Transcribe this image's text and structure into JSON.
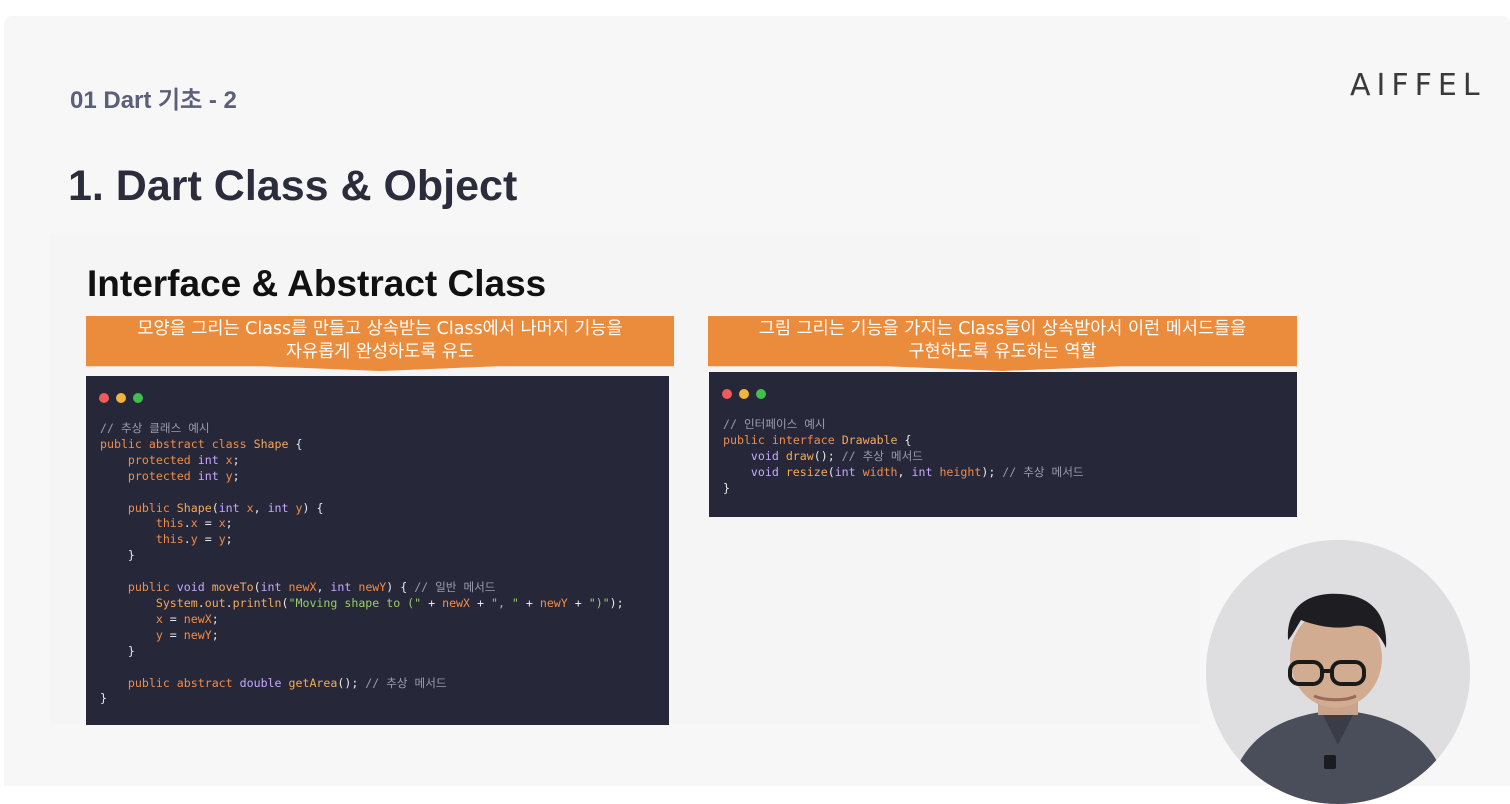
{
  "header": {
    "section_label": "01 Dart  기초 - 2",
    "logo_text": "AIFFEL",
    "title": "1. Dart Class & Object"
  },
  "content": {
    "subtitle": "Interface & Abstract Class",
    "callout_left": {
      "line1": "모양을 그리는 Class를 만들고 상속받는 Class에서 나머지 기능을",
      "line2": "자유롭게 완성하도록 유도"
    },
    "callout_right": {
      "line1": "그림 그리는 기능을 가지는 Class들이 상속받아서 이런 메서드들을",
      "line2": "구현하도록 유도하는 역할"
    },
    "code_left_lines": [
      [
        [
          "c-comment",
          "// 추상 클래스 예시"
        ]
      ],
      [
        [
          "c-kw",
          "public"
        ],
        [
          "c-plain",
          " "
        ],
        [
          "c-kw",
          "abstract"
        ],
        [
          "c-plain",
          " "
        ],
        [
          "c-kw",
          "class"
        ],
        [
          "c-plain",
          " "
        ],
        [
          "c-fn",
          "Shape"
        ],
        [
          "c-plain",
          " {"
        ]
      ],
      [
        [
          "c-plain",
          "    "
        ],
        [
          "c-kw",
          "protected"
        ],
        [
          "c-plain",
          " "
        ],
        [
          "c-type",
          "int"
        ],
        [
          "c-plain",
          " "
        ],
        [
          "c-var",
          "x"
        ],
        [
          "c-plain",
          ";"
        ]
      ],
      [
        [
          "c-plain",
          "    "
        ],
        [
          "c-kw",
          "protected"
        ],
        [
          "c-plain",
          " "
        ],
        [
          "c-type",
          "int"
        ],
        [
          "c-plain",
          " "
        ],
        [
          "c-var",
          "y"
        ],
        [
          "c-plain",
          ";"
        ]
      ],
      [
        [
          "c-plain",
          ""
        ]
      ],
      [
        [
          "c-plain",
          "    "
        ],
        [
          "c-kw",
          "public"
        ],
        [
          "c-plain",
          " "
        ],
        [
          "c-fn",
          "Shape"
        ],
        [
          "c-plain",
          "("
        ],
        [
          "c-type",
          "int"
        ],
        [
          "c-plain",
          " "
        ],
        [
          "c-var",
          "x"
        ],
        [
          "c-plain",
          ", "
        ],
        [
          "c-type",
          "int"
        ],
        [
          "c-plain",
          " "
        ],
        [
          "c-var",
          "y"
        ],
        [
          "c-plain",
          ") {"
        ]
      ],
      [
        [
          "c-plain",
          "        "
        ],
        [
          "c-kw",
          "this"
        ],
        [
          "c-plain",
          "."
        ],
        [
          "c-var",
          "x"
        ],
        [
          "c-plain",
          " = "
        ],
        [
          "c-var",
          "x"
        ],
        [
          "c-plain",
          ";"
        ]
      ],
      [
        [
          "c-plain",
          "        "
        ],
        [
          "c-kw",
          "this"
        ],
        [
          "c-plain",
          "."
        ],
        [
          "c-var",
          "y"
        ],
        [
          "c-plain",
          " = "
        ],
        [
          "c-var",
          "y"
        ],
        [
          "c-plain",
          ";"
        ]
      ],
      [
        [
          "c-plain",
          "    }"
        ]
      ],
      [
        [
          "c-plain",
          ""
        ]
      ],
      [
        [
          "c-plain",
          "    "
        ],
        [
          "c-kw",
          "public"
        ],
        [
          "c-plain",
          " "
        ],
        [
          "c-type",
          "void"
        ],
        [
          "c-plain",
          " "
        ],
        [
          "c-fn",
          "moveTo"
        ],
        [
          "c-plain",
          "("
        ],
        [
          "c-type",
          "int"
        ],
        [
          "c-plain",
          " "
        ],
        [
          "c-var",
          "newX"
        ],
        [
          "c-plain",
          ", "
        ],
        [
          "c-type",
          "int"
        ],
        [
          "c-plain",
          " "
        ],
        [
          "c-var",
          "newY"
        ],
        [
          "c-plain",
          ") { "
        ],
        [
          "c-comment",
          "// 일반 메서드"
        ]
      ],
      [
        [
          "c-plain",
          "        "
        ],
        [
          "c-fn",
          "System"
        ],
        [
          "c-plain",
          "."
        ],
        [
          "c-fn",
          "out"
        ],
        [
          "c-plain",
          "."
        ],
        [
          "c-fn",
          "println"
        ],
        [
          "c-plain",
          "("
        ],
        [
          "c-str",
          "\"Moving shape to (\""
        ],
        [
          "c-plain",
          " + "
        ],
        [
          "c-var",
          "newX"
        ],
        [
          "c-plain",
          " + "
        ],
        [
          "c-str",
          "\", \""
        ],
        [
          "c-plain",
          " + "
        ],
        [
          "c-var",
          "newY"
        ],
        [
          "c-plain",
          " + "
        ],
        [
          "c-str",
          "\")\""
        ],
        [
          "c-plain",
          ");"
        ]
      ],
      [
        [
          "c-plain",
          "        "
        ],
        [
          "c-var",
          "x"
        ],
        [
          "c-plain",
          " = "
        ],
        [
          "c-var",
          "newX"
        ],
        [
          "c-plain",
          ";"
        ]
      ],
      [
        [
          "c-plain",
          "        "
        ],
        [
          "c-var",
          "y"
        ],
        [
          "c-plain",
          " = "
        ],
        [
          "c-var",
          "newY"
        ],
        [
          "c-plain",
          ";"
        ]
      ],
      [
        [
          "c-plain",
          "    }"
        ]
      ],
      [
        [
          "c-plain",
          ""
        ]
      ],
      [
        [
          "c-plain",
          "    "
        ],
        [
          "c-kw",
          "public"
        ],
        [
          "c-plain",
          " "
        ],
        [
          "c-kw",
          "abstract"
        ],
        [
          "c-plain",
          " "
        ],
        [
          "c-type",
          "double"
        ],
        [
          "c-plain",
          " "
        ],
        [
          "c-fn",
          "getArea"
        ],
        [
          "c-plain",
          "(); "
        ],
        [
          "c-comment",
          "// 추상 메서드"
        ]
      ],
      [
        [
          "c-plain",
          "}"
        ]
      ]
    ],
    "code_right_lines": [
      [
        [
          "c-comment",
          "// 인터페이스 예시"
        ]
      ],
      [
        [
          "c-kw",
          "public"
        ],
        [
          "c-plain",
          " "
        ],
        [
          "c-kw",
          "interface"
        ],
        [
          "c-plain",
          " "
        ],
        [
          "c-fn",
          "Drawable"
        ],
        [
          "c-plain",
          " {"
        ]
      ],
      [
        [
          "c-plain",
          "    "
        ],
        [
          "c-type",
          "void"
        ],
        [
          "c-plain",
          " "
        ],
        [
          "c-fn",
          "draw"
        ],
        [
          "c-plain",
          "(); "
        ],
        [
          "c-comment",
          "// 추상 메서드"
        ]
      ],
      [
        [
          "c-plain",
          "    "
        ],
        [
          "c-type",
          "void"
        ],
        [
          "c-plain",
          " "
        ],
        [
          "c-fn",
          "resize"
        ],
        [
          "c-plain",
          "("
        ],
        [
          "c-type",
          "int"
        ],
        [
          "c-plain",
          " "
        ],
        [
          "c-var",
          "width"
        ],
        [
          "c-plain",
          ", "
        ],
        [
          "c-type",
          "int"
        ],
        [
          "c-plain",
          " "
        ],
        [
          "c-var",
          "height"
        ],
        [
          "c-plain",
          "); "
        ],
        [
          "c-comment",
          "// 추상 메서드"
        ]
      ],
      [
        [
          "c-plain",
          "}"
        ]
      ]
    ]
  },
  "colors": {
    "accent_orange": "#ea8c3c",
    "code_bg": "#262739",
    "dot_red": "#f05a5a",
    "dot_yellow": "#f3b43c",
    "dot_green": "#3fc04a"
  }
}
